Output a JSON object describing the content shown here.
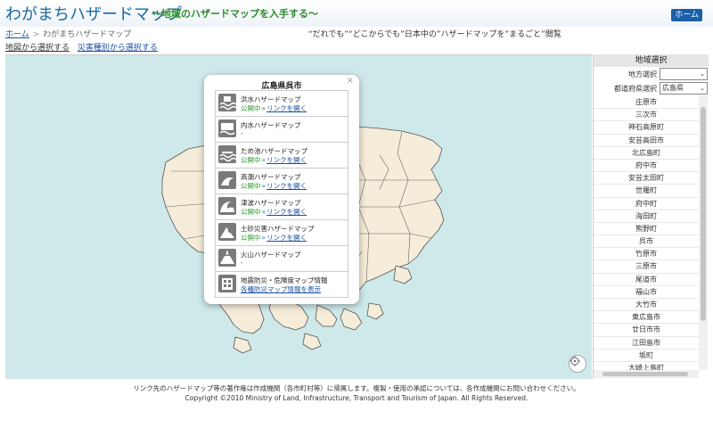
{
  "header": {
    "title": "わがまちハザードマップ",
    "subtitle": "〜地域のハザードマップを入手する〜",
    "home_button": "ホーム"
  },
  "breadcrumb": {
    "home": "ホーム",
    "separator": ">",
    "current": "わがまちハザードマップ",
    "tagline": "“だれでも”“どこからでも”日本中の”ハザードマップを”まるごと”閲覧"
  },
  "tabs": {
    "map_select": "地図から選択する",
    "disaster_select": "災害種別から選択する"
  },
  "popup": {
    "title": "広島県呉市",
    "close": "×",
    "status_open": "公開中",
    "arrow": "»",
    "link_label": "リンクを開く",
    "items": [
      {
        "name": "洪水ハザードマップ",
        "has_link": true,
        "icon": "flood-icon"
      },
      {
        "name": "内水ハザードマップ",
        "has_link": false,
        "dash": "-",
        "icon": "inland-flood-icon"
      },
      {
        "name": "ため池ハザードマップ",
        "has_link": true,
        "icon": "reservoir-icon"
      },
      {
        "name": "高潮ハザードマップ",
        "has_link": true,
        "icon": "storm-surge-icon"
      },
      {
        "name": "津波ハザードマップ",
        "has_link": true,
        "icon": "tsunami-icon"
      },
      {
        "name": "土砂災害ハザードマップ",
        "has_link": true,
        "icon": "landslide-icon"
      },
      {
        "name": "火山ハザードマップ",
        "has_link": false,
        "dash": "-",
        "icon": "volcano-icon"
      },
      {
        "name": "地震防災・危険度マップ情報",
        "has_link": true,
        "link_label": "各種防災マップ情報を表示",
        "icon": "earthquake-icon"
      }
    ]
  },
  "sidebar": {
    "title": "地域選択",
    "region_label": "地方選択",
    "region_value": "",
    "pref_label": "都道府県選択",
    "pref_value": "広島県",
    "dropdown_arrow": "⌄",
    "cities": [
      "庄原市",
      "三次市",
      "神石高原町",
      "安芸高田市",
      "北広島町",
      "府中市",
      "安芸太田町",
      "世羅町",
      "府中町",
      "海田町",
      "熊野町",
      "呉市",
      "竹原市",
      "三原市",
      "尾道市",
      "福山市",
      "大竹市",
      "東広島市",
      "廿日市市",
      "江田島市",
      "坂町",
      "大崎上島町"
    ]
  },
  "footer": {
    "line1": "リンク先のハザードマップ等の著作権は作成機関（各市町村等）に帰属します。複製・使用の承認については、各作成機関にお問い合わせください。",
    "line2": "Copyright ©2010 Ministry of Land, Infrastructure, Transport and Tourism of Japan. All Rights Reserved."
  },
  "colors": {
    "brand_blue": "#1a6aa0",
    "subtitle_green": "#2d8a2d",
    "sea": "#cfe9ea",
    "land": "#f5ecd9",
    "status_green": "#2a9a2a"
  }
}
